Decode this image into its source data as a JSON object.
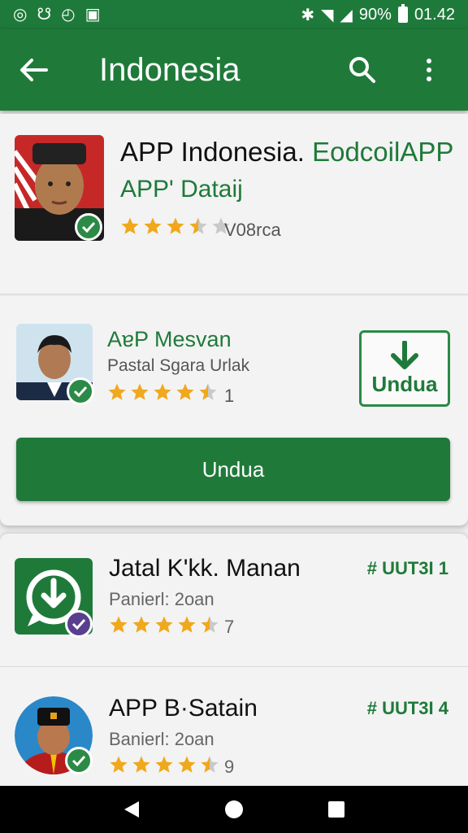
{
  "status": {
    "battery": "90%",
    "time": "01.42"
  },
  "app_bar": {
    "title": "Indonesia",
    "back_icon": "arrow-left-icon",
    "search_icon": "search-icon",
    "menu_icon": "more-vert-icon"
  },
  "featured": {
    "title": "APP Indonesia.",
    "title_accent": "EodcoilAPP",
    "subtitle": "APP' Dataij",
    "rating_label": "V08rca",
    "rating": 3.5
  },
  "promo": {
    "title": "AɐP Mesvan",
    "subtitle": "Pastal Sgara Urlak",
    "rating": 4.5,
    "count": "1",
    "install_label": "Undua",
    "button_label": "Undua"
  },
  "list": [
    {
      "title": "Jatal K'kk. Manan",
      "subtitle": "Panierl: 2oan",
      "rating": 4.5,
      "count": "7",
      "tag": "# UUT3I 1",
      "badge": "purple"
    },
    {
      "title": "APP B·Satain",
      "subtitle": "Banierl: 2oan",
      "rating": 4.5,
      "count": "9",
      "tag": "# UUT3I 4",
      "badge": "green"
    }
  ],
  "colors": {
    "primary": "#1f7a3a",
    "star": "#f0a81c"
  }
}
